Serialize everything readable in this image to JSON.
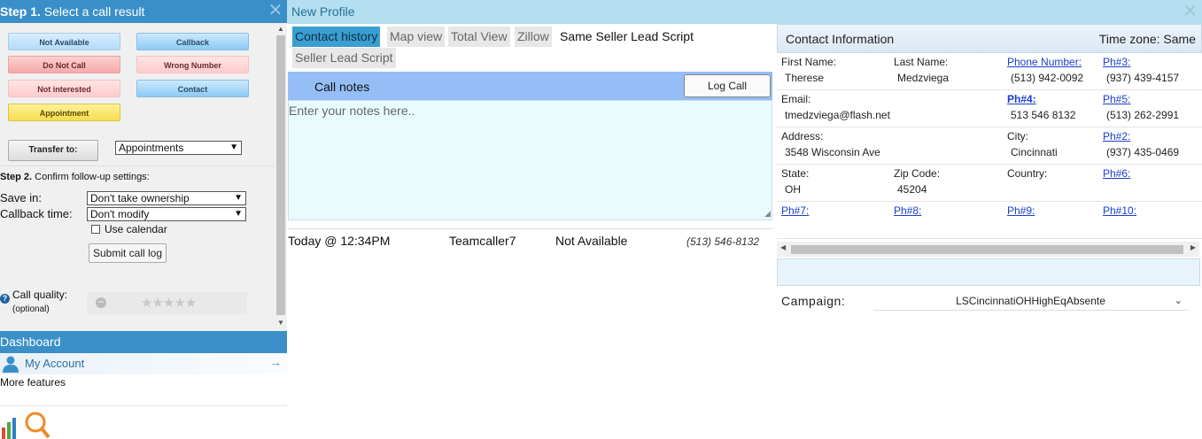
{
  "left": {
    "step1_prefix": "Step 1.",
    "step1_text": " Select a call result",
    "results": {
      "not_available": "Not Available",
      "callback": "Callback",
      "do_not_call": "Do Not Call",
      "wrong_number": "Wrong Number",
      "not_interested": "Not interested",
      "contact": "Contact",
      "appointment": "Appointment"
    },
    "transfer_label": "Transfer to:",
    "transfer_value": "Appointments",
    "step2_prefix": "Step 2.",
    "step2_text": " Confirm follow-up settings:",
    "save_in_label": "Save in:",
    "save_in_value": "Don't take ownership",
    "callback_time_label": "Callback time:",
    "callback_time_value": "Don't modify",
    "use_calendar": "Use calendar",
    "submit": "Submit call log",
    "call_quality": "Call quality:",
    "optional": "(optional)",
    "dashboard": "Dashboard",
    "my_account": "My Account",
    "more_features": "More features"
  },
  "profile": {
    "title": "New Profile",
    "tabs": [
      "Contact history",
      "Map view",
      "Total View",
      "Zillow",
      "Same Seller Lead Script",
      "Seller Lead Script"
    ],
    "call_notes_label": "Call notes",
    "log_call": "Log Call",
    "notes_placeholder": "Enter your notes here..",
    "history": {
      "time": "Today @ 12:34PM",
      "caller": "Teamcaller7",
      "result": "Not Available",
      "phone": "(513) 546-8132"
    }
  },
  "contact": {
    "title": "Contact Information",
    "timezone": "Time zone: Same",
    "first_name_label": "First Name:",
    "first_name": "Therese",
    "last_name_label": "Last Name:",
    "last_name": "Medzviega",
    "phone_label": "Phone Number:",
    "phone": "(513) 942-0092",
    "ph3_label": "Ph#3:",
    "ph3": "(937) 439-4157",
    "email_label": "Email:",
    "email": "tmedzviega@flash.net",
    "ph4_label": "Ph#4:",
    "ph4": "513 546 8132",
    "ph5_label": "Ph#5:",
    "ph5": "(513) 262-2991",
    "address_label": "Address:",
    "address": "3548 Wisconsin Ave",
    "city_label": "City:",
    "city": "Cincinnati",
    "ph2_label": "Ph#2:",
    "ph2": "(937) 435-0469",
    "state_label": "State:",
    "state": "OH",
    "zip_label": "Zip Code:",
    "zip": "45204",
    "country_label": "Country:",
    "ph6_label": "Ph#6:",
    "ph7_label": "Ph#7:",
    "ph8_label": "Ph#8:",
    "ph9_label": "Ph#9:",
    "ph10_label": "Ph#10:",
    "campaign_label": "Campaign:",
    "campaign_value": "LSCincinnatiOHHighEqAbsente"
  }
}
